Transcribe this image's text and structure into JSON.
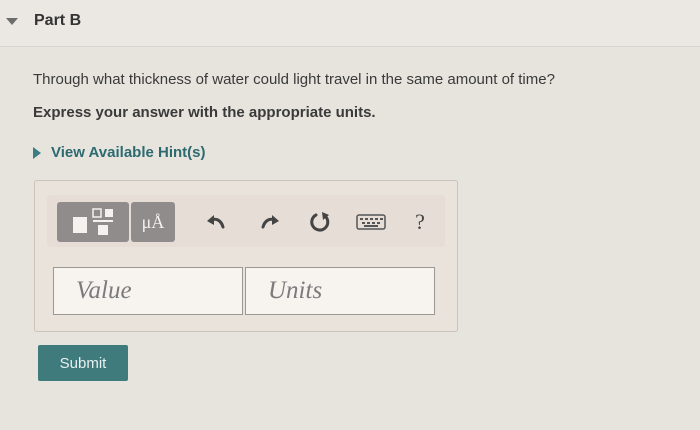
{
  "part": {
    "title": "Part B"
  },
  "question": {
    "text": "Through what thickness of water could light travel in the same amount of time?",
    "instruction": "Express your answer with the appropriate units."
  },
  "hint": {
    "label": "View Available Hint(s)"
  },
  "toolbar": {
    "templates_icon": "templates-icon",
    "units_label": "μÅ",
    "undo_icon": "undo-icon",
    "redo_icon": "redo-icon",
    "reset_icon": "reset-icon",
    "keyboard_icon": "keyboard-icon",
    "help_label": "?"
  },
  "answer": {
    "value_placeholder": "Value",
    "units_placeholder": "Units"
  },
  "submit": {
    "label": "Submit"
  },
  "colors": {
    "accent": "#3f7a7d",
    "toolbar_button": "#8f8c8b",
    "hint_text": "#2d6a70"
  }
}
